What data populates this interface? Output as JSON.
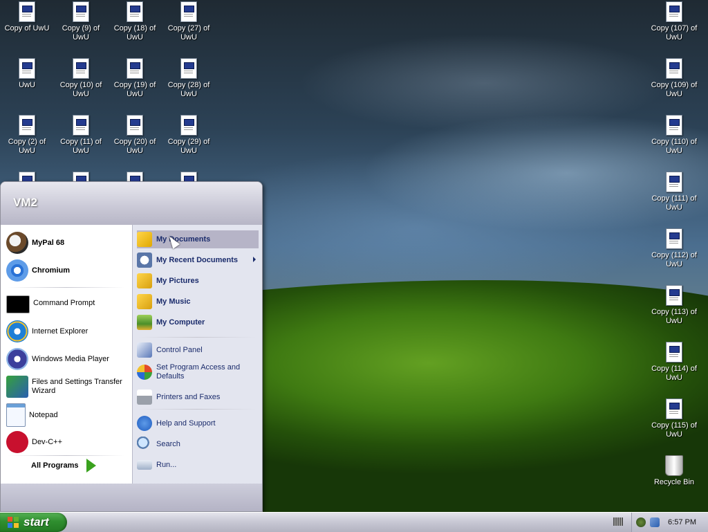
{
  "desktop": {
    "left_icons": [
      {
        "label": "Copy of UwU"
      },
      {
        "label": "Copy (9) of UwU"
      },
      {
        "label": "Copy (18) of UwU"
      },
      {
        "label": "Copy (27) of UwU"
      },
      {
        "label": "UwU"
      },
      {
        "label": "Copy (10) of UwU"
      },
      {
        "label": "Copy (19) of UwU"
      },
      {
        "label": "Copy (28) of UwU"
      },
      {
        "label": "Copy (2) of UwU"
      },
      {
        "label": "Copy (11) of UwU"
      },
      {
        "label": "Copy (20) of UwU"
      },
      {
        "label": "Copy (29) of UwU"
      }
    ],
    "right_icons": [
      {
        "label": "Copy (107) of UwU"
      },
      {
        "label": "Copy (109) of UwU"
      },
      {
        "label": "Copy (110) of UwU"
      },
      {
        "label": "Copy (111) of UwU"
      },
      {
        "label": "Copy (112) of UwU"
      },
      {
        "label": "Copy (113) of UwU"
      },
      {
        "label": "Copy (114) of UwU"
      },
      {
        "label": "Copy (115) of UwU"
      },
      {
        "label": "Recycle Bin"
      }
    ]
  },
  "start_menu": {
    "user": "VM2",
    "pinned": [
      {
        "label": "MyPal 68",
        "icon": "mypal-icon"
      },
      {
        "label": "Chromium",
        "icon": "chromium-icon"
      }
    ],
    "recent": [
      {
        "label": "Command Prompt",
        "icon": "cmd-icon"
      },
      {
        "label": "Internet Explorer",
        "icon": "ie-icon"
      },
      {
        "label": "Windows Media Player",
        "icon": "wmp-icon"
      },
      {
        "label": "Files and Settings Transfer Wizard",
        "icon": "transfer-wizard-icon"
      },
      {
        "label": "Notepad",
        "icon": "notepad-icon"
      },
      {
        "label": "Dev-C++",
        "icon": "devcpp-icon"
      }
    ],
    "all_programs": "All Programs",
    "places": [
      {
        "label": "My Documents",
        "icon": "my-documents-icon",
        "selected": true
      },
      {
        "label": "My Recent Documents",
        "icon": "recent-documents-icon",
        "submenu": true
      },
      {
        "label": "My Pictures",
        "icon": "my-pictures-icon"
      },
      {
        "label": "My Music",
        "icon": "my-music-icon"
      },
      {
        "label": "My Computer",
        "icon": "my-computer-icon"
      }
    ],
    "system": [
      {
        "label": "Control Panel",
        "icon": "control-panel-icon"
      },
      {
        "label": "Set Program Access and Defaults",
        "icon": "program-access-icon"
      },
      {
        "label": "Printers and Faxes",
        "icon": "printer-icon"
      }
    ],
    "help": [
      {
        "label": "Help and Support",
        "icon": "help-icon"
      },
      {
        "label": "Search",
        "icon": "search-icon"
      },
      {
        "label": "Run...",
        "icon": "run-icon"
      }
    ]
  },
  "taskbar": {
    "start_label": "start",
    "clock": "6:57 PM"
  },
  "colors": {
    "start_green": "#2f8e2f",
    "places_text": "#1a2b6b",
    "selection": "#b6b4c7"
  }
}
